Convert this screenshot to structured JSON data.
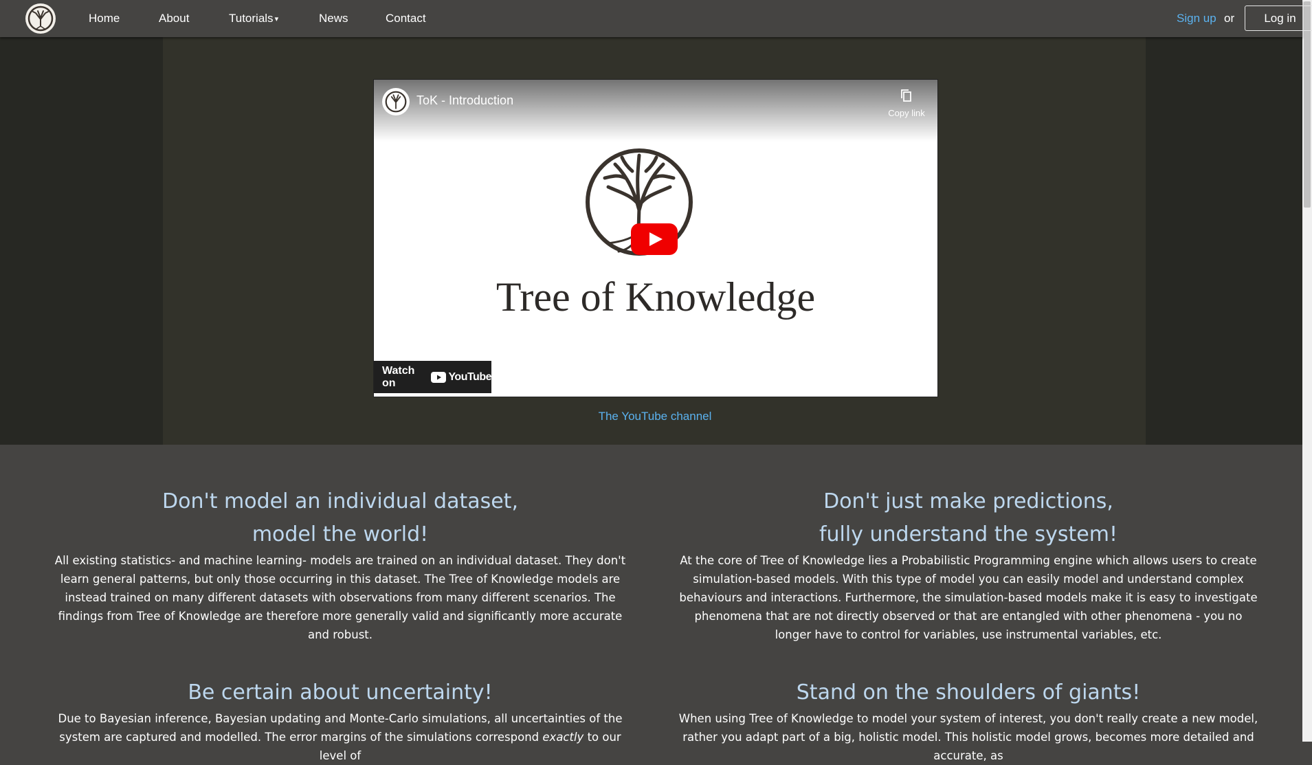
{
  "nav": {
    "items": [
      "Home",
      "About",
      "Tutorials",
      "News",
      "Contact"
    ],
    "signup": "Sign up",
    "or": "or",
    "login": "Log in"
  },
  "video": {
    "title": "ToK - Introduction",
    "copy_link": "Copy link",
    "heading": "Tree of Knowledge",
    "watch_on": "Watch on",
    "youtube_label": "YouTube",
    "channel_link": "The YouTube channel"
  },
  "features": [
    {
      "title_line1": "Don't model an individual dataset,",
      "title_line2": "model the world!",
      "text": "All existing statistics- and machine learning- models are trained on an individual dataset. They don't learn general patterns, but only those occurring in this dataset. The Tree of Knowledge models are instead trained on many different datasets with observations from many different scenarios. The findings from Tree of Knowledge are therefore more generally valid and significantly more accurate and robust."
    },
    {
      "title_line1": "Don't just make predictions,",
      "title_line2": "fully understand the system!",
      "text": "At the core of Tree of Knowledge lies a Probabilistic Programming engine which allows users to create simulation-based models. With this type of model you can easily model and understand complex behaviours and interactions. Furthermore, the simulation-based models make it is easy to investigate phenomena that are not directly observed or that are entangled with other phenomena - you no longer have to control for variables, use instrumental variables, etc."
    },
    {
      "title_line1": "Be certain about uncertainty!",
      "text_a": "Due to Bayesian inference, Bayesian updating and Monte-Carlo simulations, all uncertainties of the system are captured and modelled. The error margins of the simulations correspond ",
      "text_em": "exactly",
      "text_b": " to our level of"
    },
    {
      "title_line1": "Stand on the shoulders of giants!",
      "text": "When using Tree of Knowledge to model your system of interest, you don't really create a new model, rather you adapt part of a big, holistic model. This holistic model grows, becomes more detailed and accurate, as"
    }
  ]
}
